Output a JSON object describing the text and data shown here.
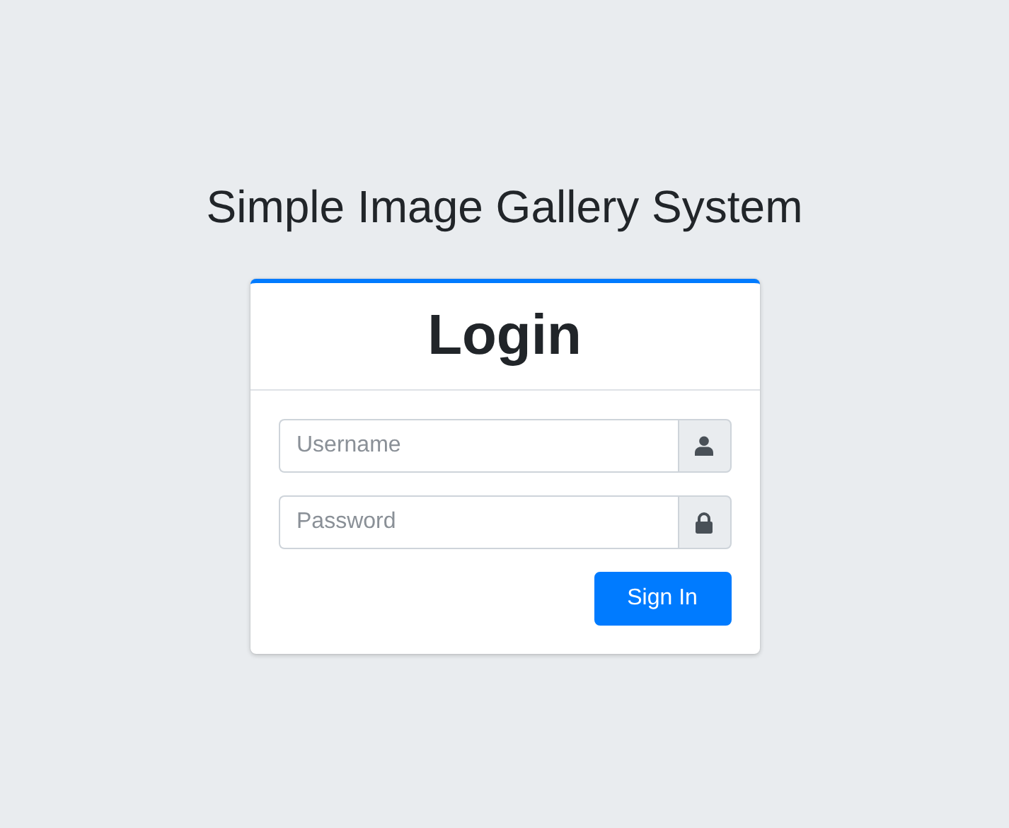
{
  "title": "Simple Image Gallery System",
  "card": {
    "heading": "Login",
    "fields": [
      {
        "placeholder": "Username",
        "kind": "user"
      },
      {
        "placeholder": "Password",
        "kind": "lock"
      }
    ],
    "button": "Sign In"
  }
}
